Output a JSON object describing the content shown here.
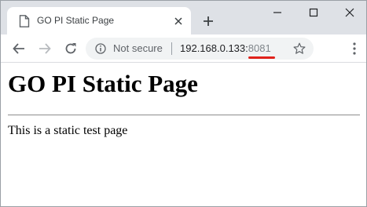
{
  "tab": {
    "title": "GO PI Static Page",
    "page_icon": "page-icon",
    "close_icon": "close-icon"
  },
  "new_tab_icon": "plus-icon",
  "window_controls": [
    "minimize-icon",
    "maximize-icon",
    "close-icon"
  ],
  "toolbar": {
    "back_icon": "arrow-left-icon",
    "forward_icon": "arrow-right-icon",
    "reload_icon": "reload-icon",
    "omnibox": {
      "info_icon": "info-icon",
      "security_label": "Not secure",
      "url_host": "192.168.0.133:",
      "url_port": "8081",
      "bookmark_icon": "star-icon"
    },
    "menu_icon": "kebab-menu-icon"
  },
  "page": {
    "heading": "GO PI Static Page",
    "text": "This is a static test page"
  },
  "colors": {
    "titlebar_bg": "#dee1e6",
    "omnibox_bg": "#f1f3f4",
    "annotation_underline": "#e0221b"
  }
}
